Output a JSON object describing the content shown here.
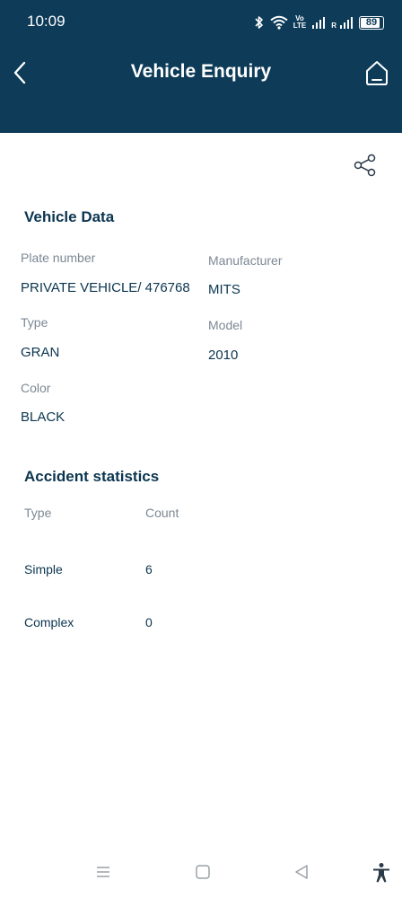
{
  "status_bar": {
    "time": "10:09",
    "network_volte_top": "Vo",
    "network_volte_bottom": "LTE",
    "roaming": "R",
    "battery": "89",
    "battery_level": 0.89,
    "icons": [
      "bluetooth-icon",
      "wifi-icon",
      "signal-icon",
      "signal-icon",
      "battery-icon"
    ]
  },
  "header": {
    "title": "Vehicle Enquiry",
    "back_icon": "chevron-left-icon",
    "home_icon": "home-icon",
    "background": "#0d3b58"
  },
  "share": {
    "icon": "share-icon"
  },
  "vehicle_data": {
    "title": "Vehicle Data",
    "plate_label": "Plate number",
    "plate_value": "PRIVATE VEHICLE/ 476768",
    "manufacturer_label": "Manufacturer",
    "manufacturer_value": "MITS",
    "type_label": "Type",
    "type_value": "GRAN",
    "model_label": "Model",
    "model_value": "2010",
    "color_label": "Color",
    "color_value": "BLACK"
  },
  "accident_statistics": {
    "title": "Accident statistics",
    "header_type": "Type",
    "header_count": "Count",
    "rows": [
      {
        "type": "Simple",
        "count": "6"
      },
      {
        "type": "Complex",
        "count": "0"
      }
    ]
  },
  "bottom_nav": {
    "icons": [
      "menu-icon",
      "square-icon",
      "back-triangle-icon",
      "accessibility-icon"
    ]
  }
}
